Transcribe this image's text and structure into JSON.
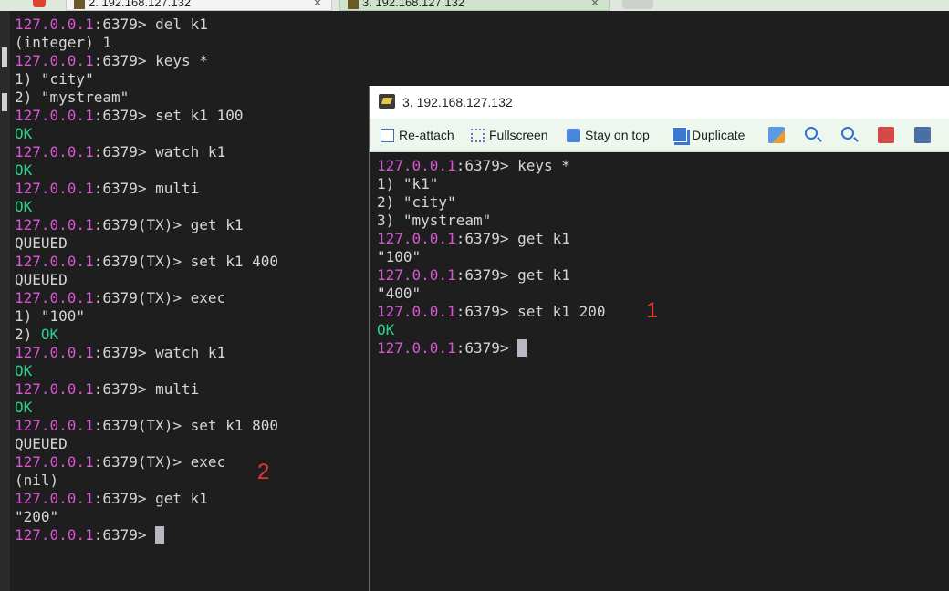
{
  "tabs": {
    "active_title": "2. 192.168.127.132",
    "inactive_title": "3. 192.168.127.132"
  },
  "left_terminal": {
    "lines": [
      {
        "ip": "127.0.0.1",
        "rest": ":6379> del k1"
      },
      {
        "out": "(integer) 1"
      },
      {
        "ip": "127.0.0.1",
        "rest": ":6379> keys *"
      },
      {
        "out": "1) \"city\""
      },
      {
        "out": "2) \"mystream\""
      },
      {
        "ip": "127.0.0.1",
        "rest": ":6379> set k1 100"
      },
      {
        "ok": "OK"
      },
      {
        "ip": "127.0.0.1",
        "rest": ":6379> watch k1"
      },
      {
        "ok": "OK"
      },
      {
        "ip": "127.0.0.1",
        "rest": ":6379> multi"
      },
      {
        "ok": "OK"
      },
      {
        "ip": "127.0.0.1",
        "rest": ":6379(TX)> get k1"
      },
      {
        "out": "QUEUED"
      },
      {
        "ip": "127.0.0.1",
        "rest": ":6379(TX)> set k1 400"
      },
      {
        "out": "QUEUED"
      },
      {
        "ip": "127.0.0.1",
        "rest": ":6379(TX)> exec"
      },
      {
        "out": "1) \"100\""
      },
      {
        "out": "2) ",
        "ok": "OK"
      },
      {
        "ip": "127.0.0.1",
        "rest": ":6379> watch k1"
      },
      {
        "ok": "OK"
      },
      {
        "ip": "127.0.0.1",
        "rest": ":6379> multi"
      },
      {
        "ok": "OK"
      },
      {
        "ip": "127.0.0.1",
        "rest": ":6379(TX)> set k1 800"
      },
      {
        "out": "QUEUED"
      },
      {
        "ip": "127.0.0.1",
        "rest": ":6379(TX)> exec"
      },
      {
        "out": "(nil)"
      },
      {
        "ip": "127.0.0.1",
        "rest": ":6379> get k1"
      },
      {
        "out": "\"200\""
      },
      {
        "ip": "127.0.0.1",
        "rest": ":6379> ",
        "cursor": true
      }
    ]
  },
  "right_window": {
    "title": "3. 192.168.127.132",
    "toolbar": {
      "reattach": "Re-attach",
      "fullscreen": "Fullscreen",
      "stay_on_top": "Stay on top",
      "duplicate": "Duplicate"
    },
    "lines": [
      {
        "ip": "127.0.0.1",
        "rest": ":6379> keys *"
      },
      {
        "out": "1) \"k1\""
      },
      {
        "out": "2) \"city\""
      },
      {
        "out": "3) \"mystream\""
      },
      {
        "ip": "127.0.0.1",
        "rest": ":6379> get k1"
      },
      {
        "out": "\"100\""
      },
      {
        "ip": "127.0.0.1",
        "rest": ":6379> get k1"
      },
      {
        "out": "\"400\""
      },
      {
        "ip": "127.0.0.1",
        "rest": ":6379> set k1 200"
      },
      {
        "ok": "OK"
      },
      {
        "ip": "127.0.0.1",
        "rest": ":6379> ",
        "cursor": true
      }
    ]
  },
  "annotations": {
    "mark1": "1",
    "mark2": "2"
  },
  "colors": {
    "prompt_ip": "#d957d4",
    "ok": "#2ecf8e",
    "annotation": "#e33838"
  }
}
